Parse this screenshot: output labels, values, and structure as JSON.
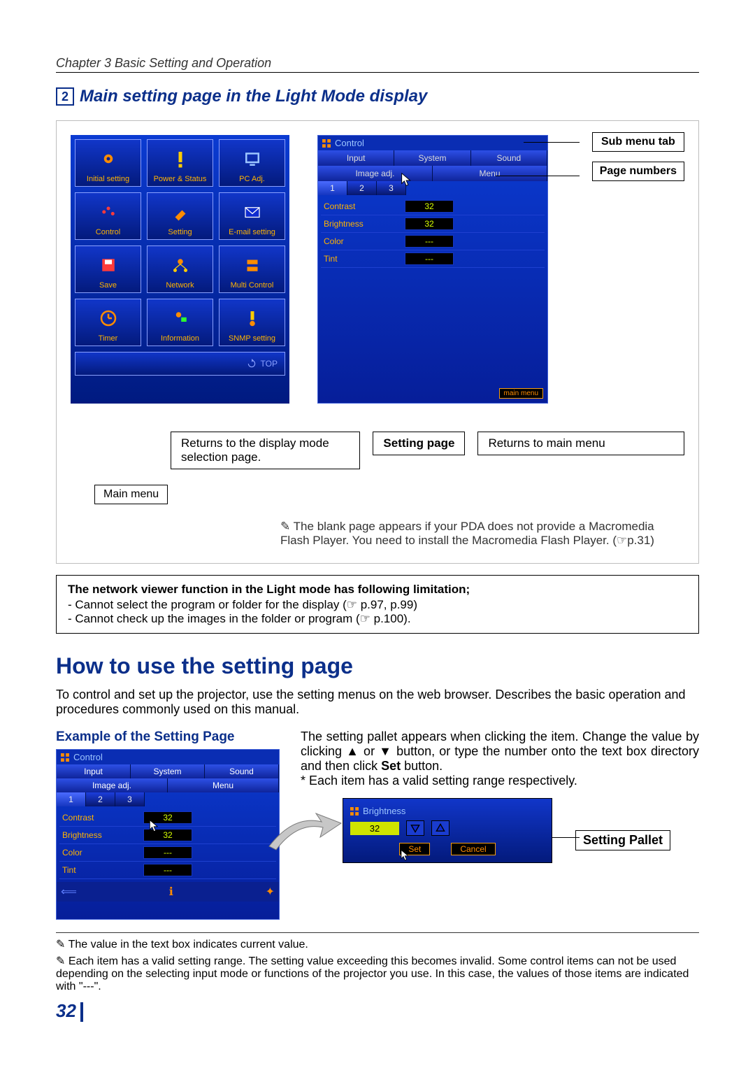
{
  "chapter": "Chapter 3 Basic Setting and Operation",
  "section_num": "2",
  "section_title": "Main setting page in the Light Mode display",
  "menu_items": [
    {
      "label": "Initial setting",
      "icon": "gear-icon"
    },
    {
      "label": "Power & Status",
      "icon": "warning-icon"
    },
    {
      "label": "PC Adj.",
      "icon": "monitor-icon"
    },
    {
      "label": "Control",
      "icon": "slider-icon"
    },
    {
      "label": "Setting",
      "icon": "wrench-icon"
    },
    {
      "label": "E-mail setting",
      "icon": "mail-icon"
    },
    {
      "label": "Save",
      "icon": "save-icon"
    },
    {
      "label": "Network",
      "icon": "network-icon"
    },
    {
      "label": "Multi Control",
      "icon": "multi-icon"
    },
    {
      "label": "Timer",
      "icon": "clock-icon"
    },
    {
      "label": "Information",
      "icon": "info-icon"
    },
    {
      "label": "SNMP setting",
      "icon": "snmp-icon"
    }
  ],
  "top_link": "TOP",
  "control_panel": {
    "title": "Control",
    "tabs": [
      "Input",
      "System",
      "Sound"
    ],
    "tabs2": [
      "Image adj.",
      "Menu"
    ],
    "pages": [
      "1",
      "2",
      "3"
    ],
    "rows": [
      {
        "k": "Contrast",
        "v": "32"
      },
      {
        "k": "Brightness",
        "v": "32"
      },
      {
        "k": "Color",
        "v": "---"
      },
      {
        "k": "Tint",
        "v": "---"
      }
    ],
    "mainmenu_btn": "main menu"
  },
  "callouts": {
    "submenu": "Sub menu tab",
    "pagenumbers": "Page numbers",
    "returns_top": "Returns to the display mode selection page.",
    "setting_page": "Setting page",
    "returns_main": "Returns to main menu",
    "main_menu": "Main menu"
  },
  "below_note": "The blank page appears if your PDA does not provide a Macromedia Flash Player. You need to install the Macromedia Flash Player. (☞p.31)",
  "limitation": {
    "hdr": "The network viewer function in the Light mode has following limitation;",
    "l1": "- Cannot select the program or folder for the display (☞ p.97, p.99)",
    "l2": "- Cannot check up the images in the folder or program (☞ p.100)."
  },
  "h2": "How to use the setting page",
  "intro": "To control and set up the projector, use the setting menus on the web browser. Describes the basic operation and procedures commonly used on this manual.",
  "example_title": "Example of the Setting Page",
  "example_text": "The setting pallet appears when clicking the item. Change the value by clicking ▲ or ▼ button, or type the number onto the text box directory and then click ",
  "set_word": "Set",
  "example_text2": " button.",
  "example_note": "* Each item has a valid setting range respectively.",
  "pallet": {
    "title": "Brightness",
    "value": "32",
    "set": "Set",
    "cancel": "Cancel",
    "label": "Setting Pallet"
  },
  "footnotes": {
    "f1": "The value in the text box indicates current value.",
    "f2": "Each item has a valid setting range. The setting value exceeding this becomes invalid. Some control items can not be used depending on the selecting input mode or functions of the projector you use. In this case, the values of those items are indicated with \"---\"."
  },
  "page_number": "32"
}
